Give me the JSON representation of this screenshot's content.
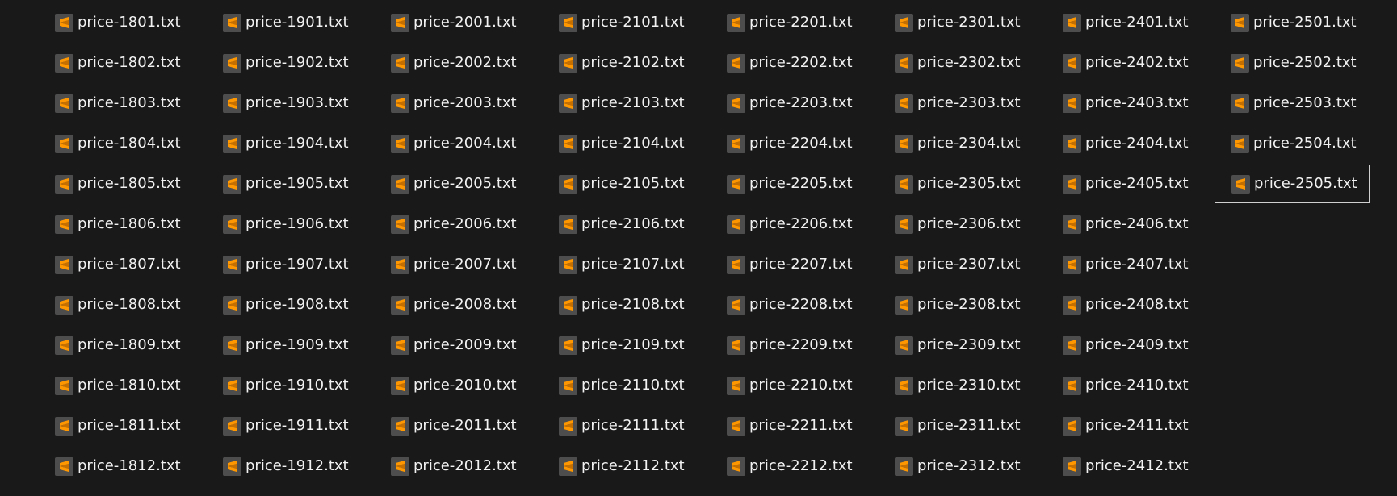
{
  "file_columns": [
    [
      "price-1801.txt",
      "price-1802.txt",
      "price-1803.txt",
      "price-1804.txt",
      "price-1805.txt",
      "price-1806.txt",
      "price-1807.txt",
      "price-1808.txt",
      "price-1809.txt",
      "price-1810.txt",
      "price-1811.txt",
      "price-1812.txt"
    ],
    [
      "price-1901.txt",
      "price-1902.txt",
      "price-1903.txt",
      "price-1904.txt",
      "price-1905.txt",
      "price-1906.txt",
      "price-1907.txt",
      "price-1908.txt",
      "price-1909.txt",
      "price-1910.txt",
      "price-1911.txt",
      "price-1912.txt"
    ],
    [
      "price-2001.txt",
      "price-2002.txt",
      "price-2003.txt",
      "price-2004.txt",
      "price-2005.txt",
      "price-2006.txt",
      "price-2007.txt",
      "price-2008.txt",
      "price-2009.txt",
      "price-2010.txt",
      "price-2011.txt",
      "price-2012.txt"
    ],
    [
      "price-2101.txt",
      "price-2102.txt",
      "price-2103.txt",
      "price-2104.txt",
      "price-2105.txt",
      "price-2106.txt",
      "price-2107.txt",
      "price-2108.txt",
      "price-2109.txt",
      "price-2110.txt",
      "price-2111.txt",
      "price-2112.txt"
    ],
    [
      "price-2201.txt",
      "price-2202.txt",
      "price-2203.txt",
      "price-2204.txt",
      "price-2205.txt",
      "price-2206.txt",
      "price-2207.txt",
      "price-2208.txt",
      "price-2209.txt",
      "price-2210.txt",
      "price-2211.txt",
      "price-2212.txt"
    ],
    [
      "price-2301.txt",
      "price-2302.txt",
      "price-2303.txt",
      "price-2304.txt",
      "price-2305.txt",
      "price-2306.txt",
      "price-2307.txt",
      "price-2308.txt",
      "price-2309.txt",
      "price-2310.txt",
      "price-2311.txt",
      "price-2312.txt"
    ],
    [
      "price-2401.txt",
      "price-2402.txt",
      "price-2403.txt",
      "price-2404.txt",
      "price-2405.txt",
      "price-2406.txt",
      "price-2407.txt",
      "price-2408.txt",
      "price-2409.txt",
      "price-2410.txt",
      "price-2411.txt",
      "price-2412.txt"
    ],
    [
      "price-2501.txt",
      "price-2502.txt",
      "price-2503.txt",
      "price-2504.txt",
      "price-2505.txt"
    ]
  ],
  "selected_file": "price-2505.txt",
  "file_icon": "sublime-text-file-icon",
  "colors": {
    "background": "#191919",
    "text": "#f2f2f2",
    "icon_tile": "#4d4d4d",
    "icon_accent": "#ff9800",
    "selection_border": "#d0d0d0"
  }
}
